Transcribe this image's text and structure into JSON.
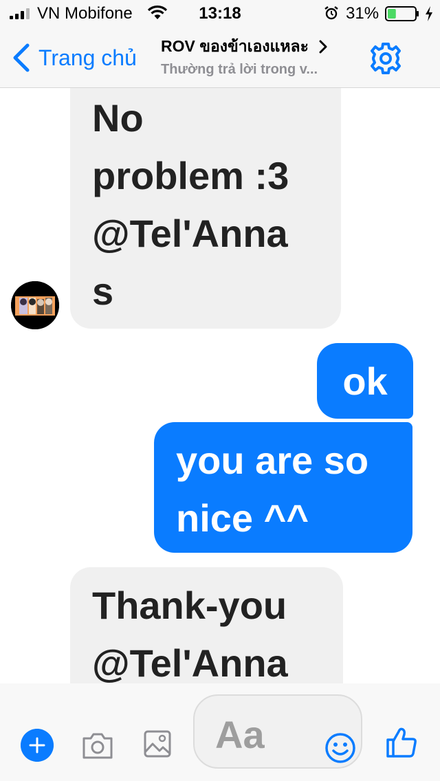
{
  "status_bar": {
    "carrier": "VN Mobifone",
    "time": "13:18",
    "battery_percent": "31%",
    "battery_level": 0.31,
    "battery_color": "#4cd964",
    "icons": [
      "signal-icon",
      "wifi-icon",
      "alarm-icon",
      "battery-icon",
      "charging-icon"
    ]
  },
  "nav": {
    "back_label": "Trang chủ",
    "title": "ROV ของข้าเองแหละ",
    "subtitle": "Thường trả lời trong v...",
    "icons": [
      "chevron-left-icon",
      "chevron-right-icon",
      "gear-icon"
    ],
    "accent": "#0a7cff"
  },
  "messages": [
    {
      "direction": "incoming",
      "lines": [
        "No",
        "problem :3",
        "@Tel'Anna",
        "s"
      ]
    },
    {
      "direction": "outgoing",
      "lines": [
        "ok"
      ]
    },
    {
      "direction": "outgoing",
      "lines": [
        "you are so",
        "nice ^^"
      ]
    },
    {
      "direction": "incoming",
      "lines": [
        "Thank-you",
        "@Tel'Anna"
      ]
    }
  ],
  "composer": {
    "placeholder": "Aa",
    "icons": [
      "plus-icon",
      "camera-icon",
      "photo-icon",
      "emoji-icon",
      "thumbs-up-icon"
    ]
  }
}
